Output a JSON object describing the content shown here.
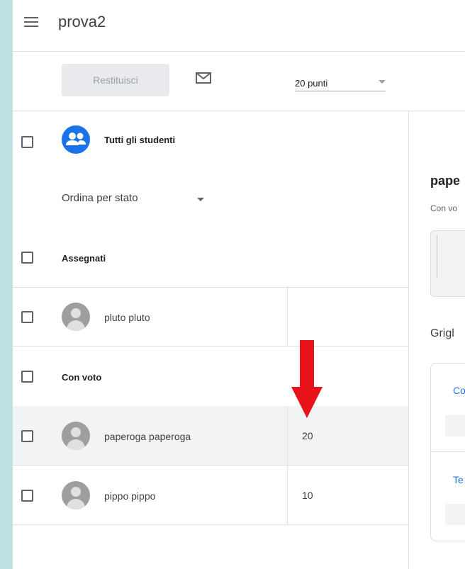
{
  "header": {
    "title": "prova2"
  },
  "toolbar": {
    "return_label": "Restituisci",
    "points": "20 punti"
  },
  "student_list": {
    "all_students": "Tutti gli studenti",
    "sort_label": "Ordina per stato",
    "sections": [
      {
        "label": "Assegnati"
      },
      {
        "label": "Con voto"
      }
    ],
    "students": [
      {
        "name": "pluto pluto",
        "grade": ""
      },
      {
        "name": "paperoga paperoga",
        "grade": "20"
      },
      {
        "name": "pippo pippo",
        "grade": "10"
      }
    ]
  },
  "detail": {
    "title": "pape",
    "subtitle": "Con vo",
    "rubric_label": "Grigl",
    "criteria": [
      "Co",
      "Te"
    ]
  },
  "colors": {
    "accent": "#1a73e8",
    "arrow": "#e8121b",
    "background": "#bde3e3"
  },
  "icons": [
    "menu-icon",
    "mail-icon",
    "people-icon",
    "person-icon",
    "chevron-down-icon",
    "arrow-down-icon"
  ]
}
